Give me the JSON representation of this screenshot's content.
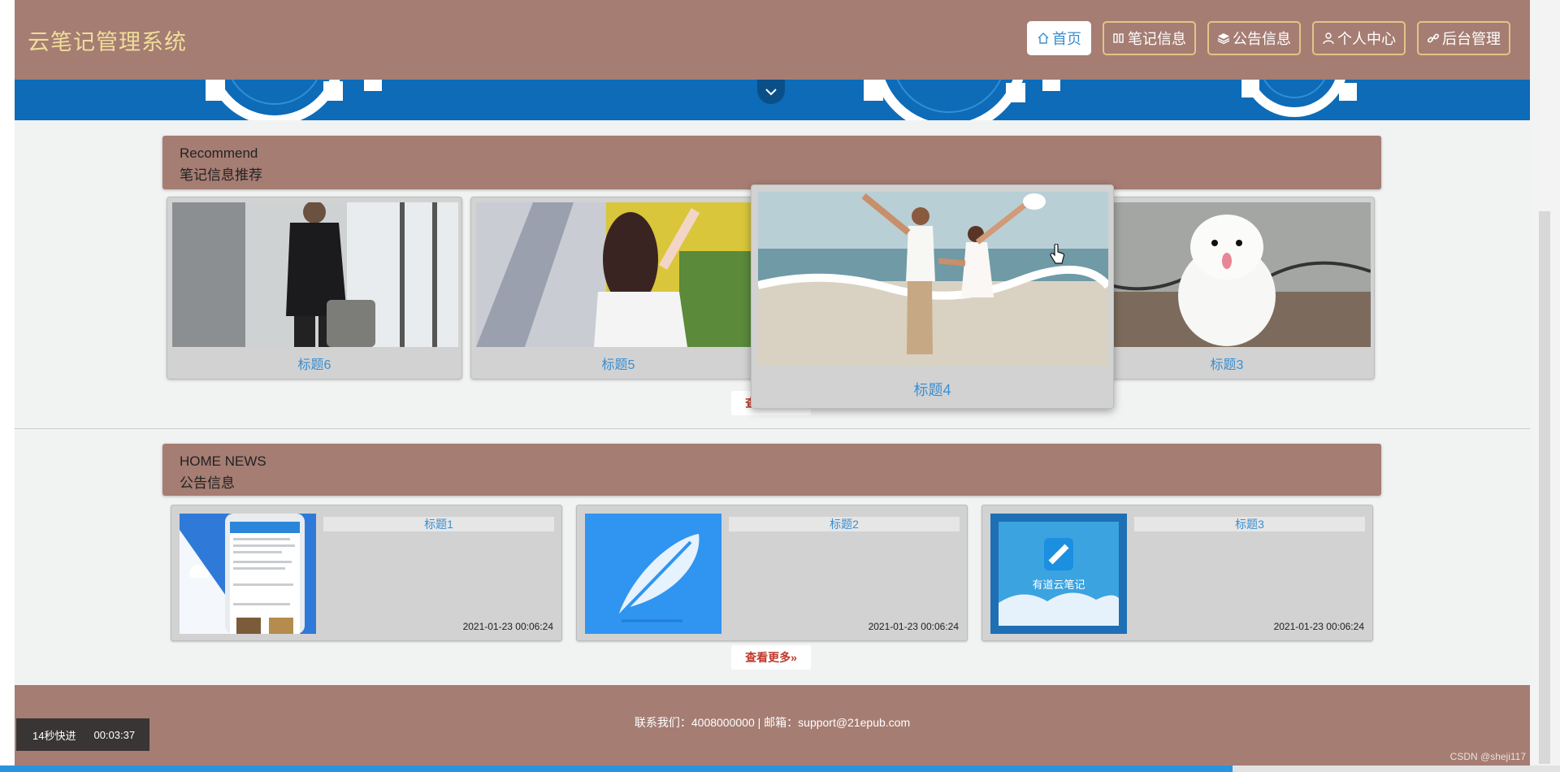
{
  "app": {
    "title": "云笔记管理系统"
  },
  "nav": {
    "home": "首页",
    "notes": "笔记信息",
    "notices": "公告信息",
    "profile": "个人中心",
    "admin": "后台管理"
  },
  "recommend": {
    "heading_en": "Recommend",
    "heading_cn": "笔记信息推荐",
    "cards": [
      "标题6",
      "标题5",
      "标题4",
      "标题3"
    ],
    "more": "查看更多»"
  },
  "news": {
    "heading_en": "HOME NEWS",
    "heading_cn": "公告信息",
    "items": [
      {
        "title": "标题1",
        "date": "2021-01-23 00:06:24"
      },
      {
        "title": "标题2",
        "date": "2021-01-23 00:06:24"
      },
      {
        "title": "标题3",
        "date": "2021-01-23 00:06:24",
        "logo_text": "有道云笔记"
      }
    ],
    "more": "查看更多»"
  },
  "footer": {
    "contact": "联系我们：4008000000 | 邮箱：support@21epub.com"
  },
  "player": {
    "speed": "14秒快进",
    "time": "00:03:37",
    "progress": 0.79
  },
  "watermark": "CSDN @sheji117",
  "colors": {
    "primary": "#a57d73",
    "brand": "#f0dd9a",
    "accent": "#3a8fd0",
    "more": "#c0392b"
  }
}
